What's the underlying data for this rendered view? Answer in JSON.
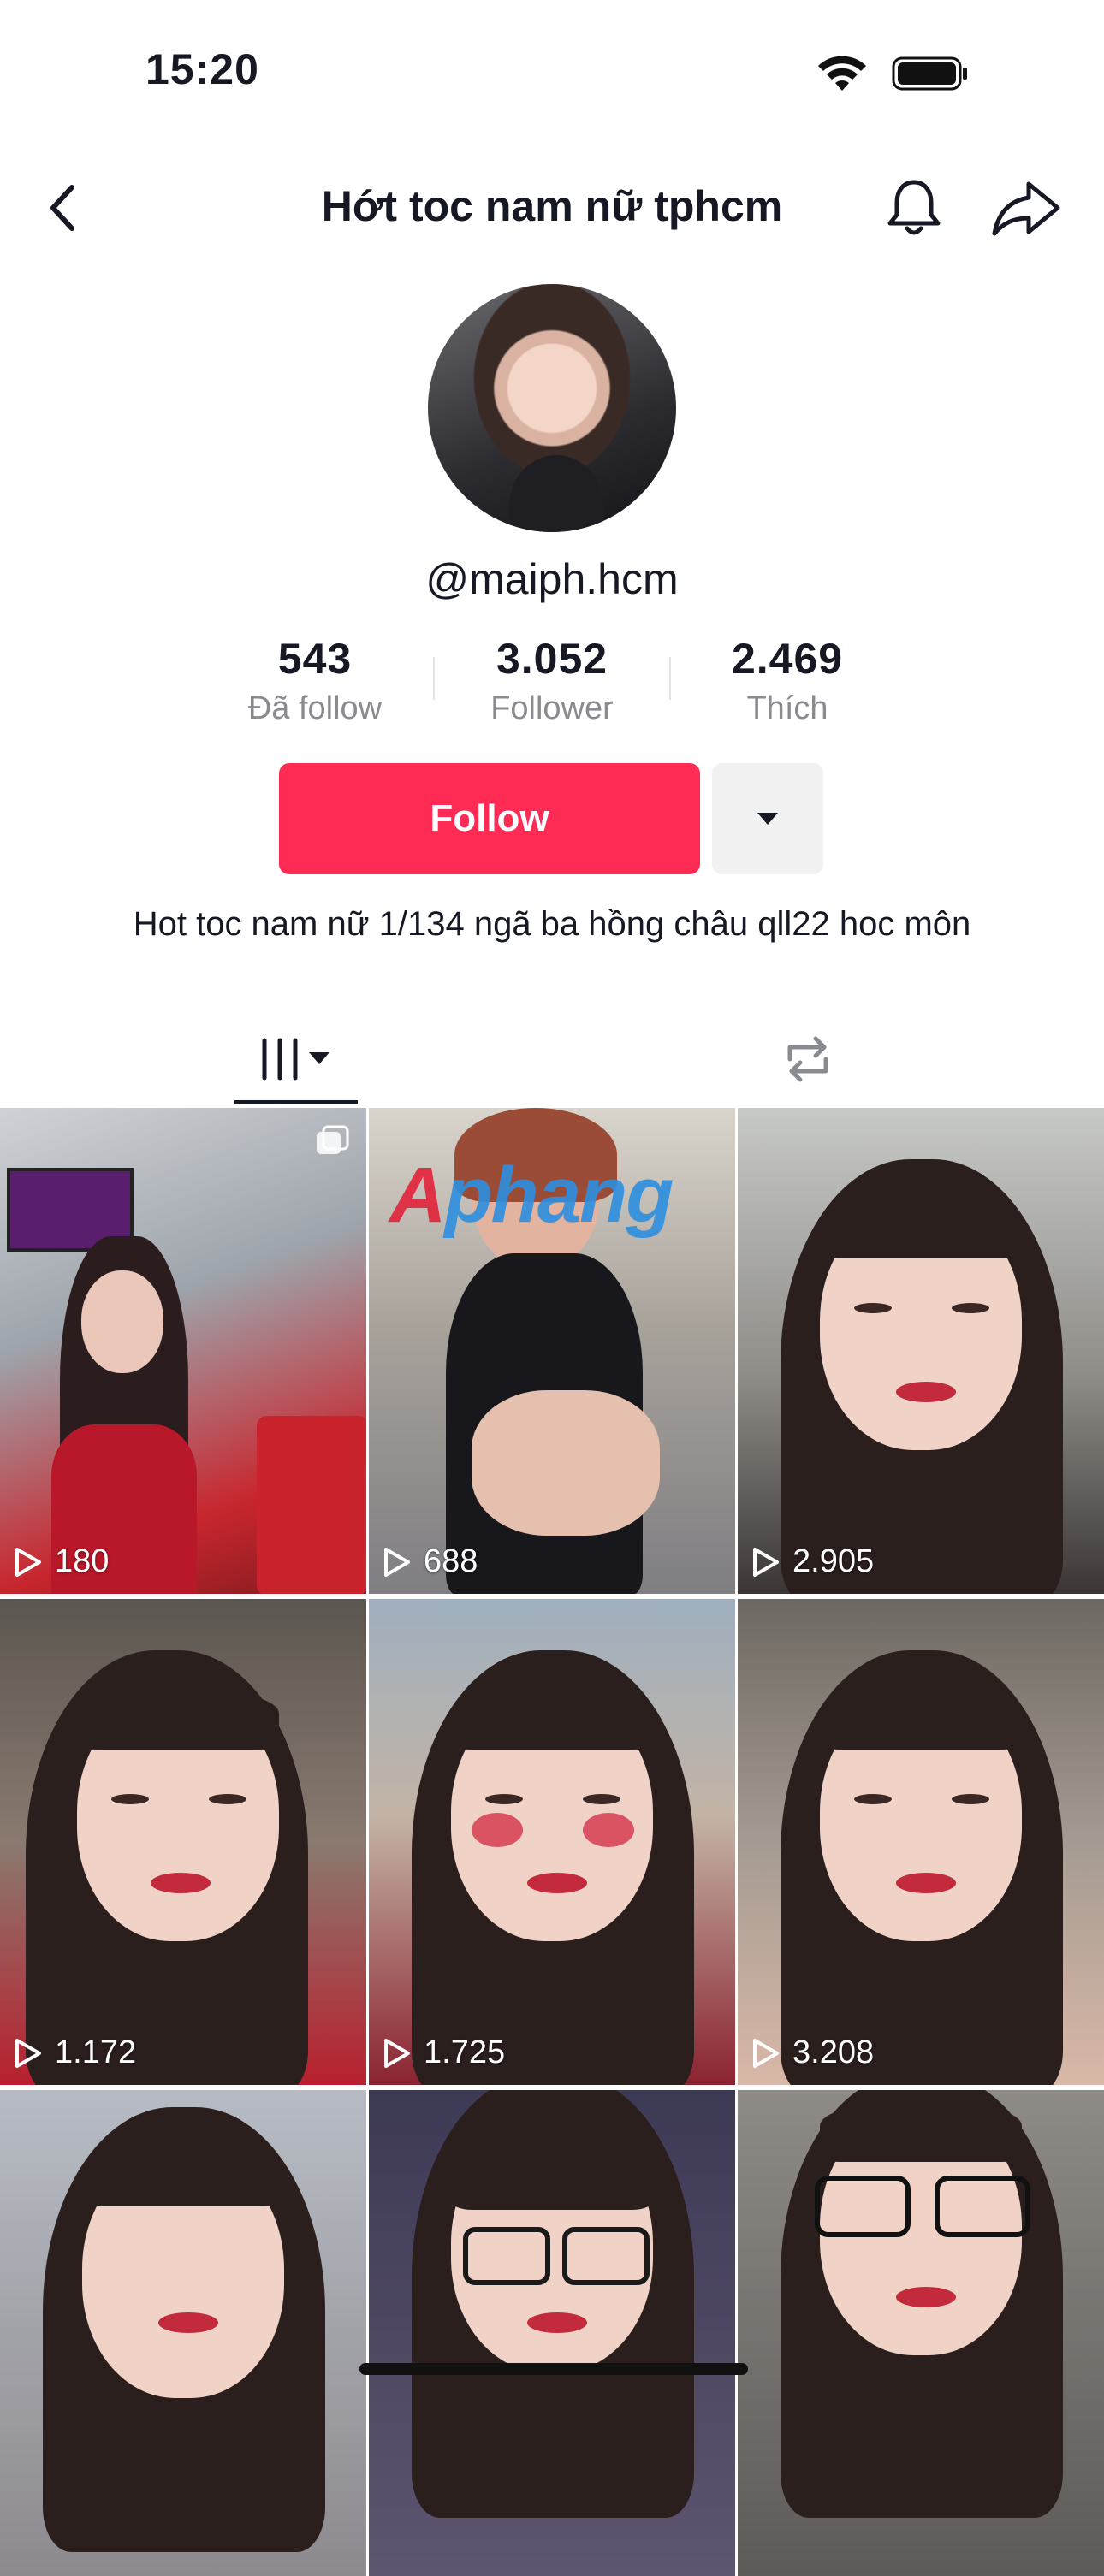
{
  "status_bar": {
    "time": "15:20"
  },
  "nav": {
    "title": "Hớt toc nam nữ tphcm"
  },
  "profile": {
    "username": "@maiph.hcm",
    "stats": [
      {
        "value": "543",
        "label": "Đã follow"
      },
      {
        "value": "3.052",
        "label": "Follower"
      },
      {
        "value": "2.469",
        "label": "Thích"
      }
    ],
    "follow_label": "Follow",
    "bio": "Hot toc nam nữ 1/134 ngã ba hồng châu qll22 hoc môn"
  },
  "tabs": [
    {
      "icon": "videos-grid-icon",
      "selected": true
    },
    {
      "icon": "repost-icon",
      "selected": false
    }
  ],
  "videos": [
    {
      "views": "180",
      "pinned": true
    },
    {
      "views": "688",
      "watermark": "Aphang"
    },
    {
      "views": "2.905"
    },
    {
      "views": "1.172"
    },
    {
      "views": "1.725"
    },
    {
      "views": "3.208"
    },
    {
      "views": ""
    },
    {
      "views": ""
    },
    {
      "views": ""
    }
  ],
  "colors": {
    "accent": "#fe2c55",
    "text": "#161823",
    "secondary": "#8a8b91"
  }
}
